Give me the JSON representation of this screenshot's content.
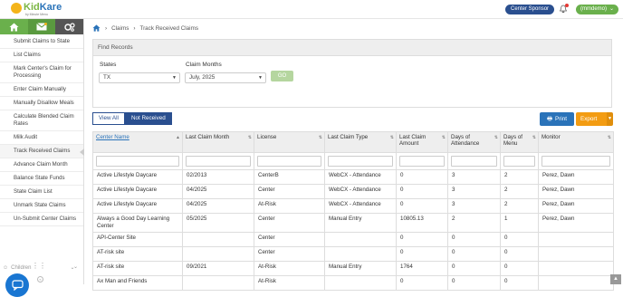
{
  "logo": {
    "name_a": "Kid",
    "name_b": "Kare",
    "tagline": "by Minute Menu"
  },
  "header": {
    "sponsor_label": "Center Sponsor",
    "user_label": "(mmdemo)"
  },
  "sidebar": {
    "items": [
      {
        "label": "Submit Claims to State"
      },
      {
        "label": "List Claims"
      },
      {
        "label": "Mark Center's Claim for Processing"
      },
      {
        "label": "Enter Claim Manually"
      },
      {
        "label": "Manually Disallow Meals"
      },
      {
        "label": "Calculate Blended Claim Rates"
      },
      {
        "label": "Milk Audit"
      },
      {
        "label": "Track Received Claims"
      },
      {
        "label": "Advance Claim Month"
      },
      {
        "label": "Balance State Funds"
      },
      {
        "label": "State Claim List"
      },
      {
        "label": "Unmark State Claims"
      },
      {
        "label": "Un-Submit Center Claims"
      }
    ],
    "children_label": "Children"
  },
  "breadcrumb": {
    "item1": "Claims",
    "item2": "Track Received Claims"
  },
  "find": {
    "title": "Find Records",
    "states_label": "States",
    "states_value": "TX",
    "months_label": "Claim Months",
    "months_value": "July, 2025",
    "go_label": "GO"
  },
  "toolbar": {
    "view_all": "View All",
    "not_received": "Not Received",
    "print": "Print",
    "export": "Export"
  },
  "table": {
    "columns": [
      "Center Name",
      "Last Claim Month",
      "License",
      "Last Claim Type",
      "Last Claim Amount",
      "Days of Attendance",
      "Days of Menu",
      "Monitor"
    ],
    "rows": [
      [
        "Active Lifestyle Daycare",
        "02/2013",
        "CenterB",
        "WebCX - Attendance",
        "0",
        "3",
        "2",
        "Perez, Dawn"
      ],
      [
        "Active Lifestyle Daycare",
        "04/2025",
        "Center",
        "WebCX - Attendance",
        "0",
        "3",
        "2",
        "Perez, Dawn"
      ],
      [
        "Active Lifestyle Daycare",
        "04/2025",
        "At-Risk",
        "WebCX - Attendance",
        "0",
        "3",
        "2",
        "Perez, Dawn"
      ],
      [
        "Always a Good Day Learning Center",
        "05/2025",
        "Center",
        "Manual Entry",
        "10805.13",
        "2",
        "1",
        "Perez, Dawn"
      ],
      [
        "API-Center Site",
        "",
        "Center",
        "",
        "0",
        "0",
        "0",
        ""
      ],
      [
        "AT-risk site",
        "",
        "Center",
        "",
        "0",
        "0",
        "0",
        ""
      ],
      [
        "AT-risk site",
        "09/2021",
        "At-Risk",
        "Manual Entry",
        "1764",
        "0",
        "0",
        ""
      ],
      [
        "Ax Man and Friends",
        "",
        "At-Risk",
        "",
        "0",
        "0",
        "0",
        ""
      ]
    ]
  }
}
